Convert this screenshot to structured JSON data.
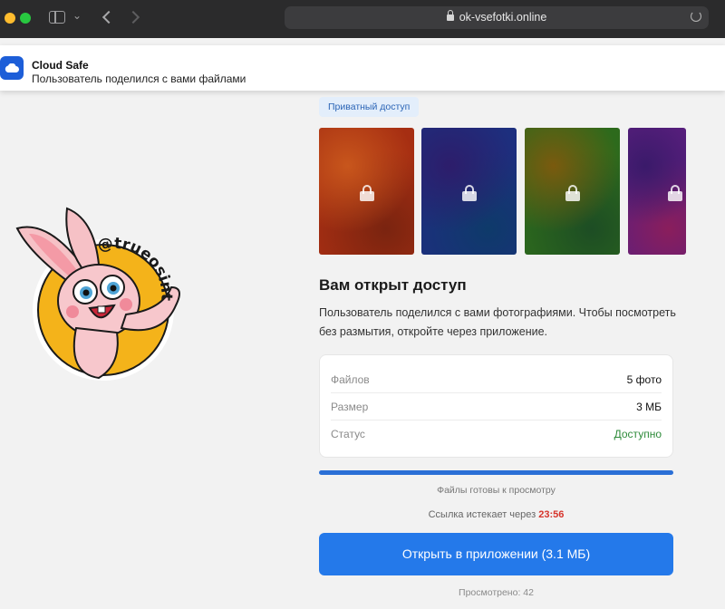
{
  "browser": {
    "url": "ok-vsefotki.online",
    "icons": [
      "sidebar-icon",
      "chevron-down-icon",
      "back-icon",
      "forward-icon",
      "lock-icon",
      "reload-icon"
    ]
  },
  "notification": {
    "app_name": "Cloud Safe",
    "message": "Пользователь поделился с вами файлами",
    "icon": "cloud-icon",
    "icon_color": "#1d5ed8"
  },
  "sticker": {
    "handle": "@trueosint"
  },
  "main": {
    "badge": "Приватный доступ",
    "tiles": [
      {
        "colors": [
          "#a62e12",
          "#7a2410",
          "#c8561c"
        ],
        "icon": "lock-icon"
      },
      {
        "colors": [
          "#1d2f7e",
          "#0e3a6a",
          "#2d1d6b"
        ],
        "icon": "lock-icon"
      },
      {
        "colors": [
          "#2d6a1c",
          "#1d4d24",
          "#7a5a0e"
        ],
        "icon": "lock-icon"
      },
      {
        "colors": [
          "#5a1f7e",
          "#8a1e5c",
          "#3a1a6a"
        ],
        "icon": "lock-icon"
      }
    ],
    "heading": "Вам открыт доступ",
    "description": "Пользователь поделился с вами фотографиями. Чтобы посмотреть без размытия, откройте через приложение.",
    "info": [
      {
        "label": "Файлов",
        "value": "5 фото"
      },
      {
        "label": "Размер",
        "value": "3 МБ"
      },
      {
        "label": "Статус",
        "value": "Доступно"
      }
    ],
    "status_color": "#2e8b3a",
    "progress_percent": 100,
    "ready_text": "Файлы готовы к просмотру",
    "expire_label": "Ссылка истекает через",
    "expire_time": "23:56",
    "open_button": "Открыть в приложении (3.1 МБ)",
    "viewed": "Просмотрено: 42",
    "accent_color": "#2479ea"
  }
}
